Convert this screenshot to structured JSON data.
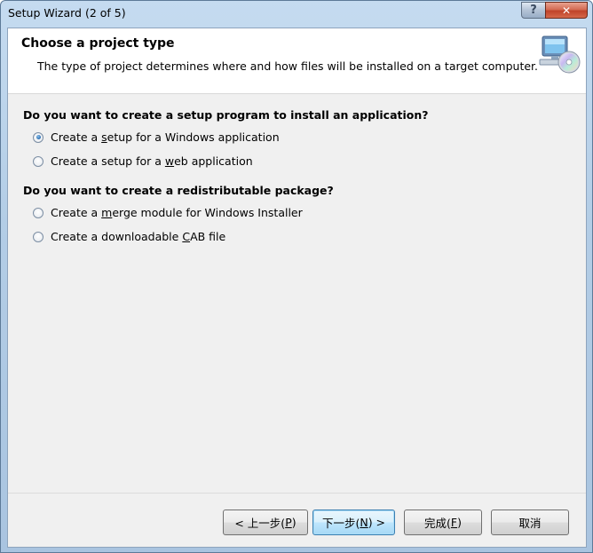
{
  "window": {
    "title": "Setup Wizard (2 of 5)",
    "help_glyph": "?",
    "close_glyph": "✕"
  },
  "header": {
    "title": "Choose a project type",
    "description": "The type of project determines where and how files will be installed on a target computer.",
    "icon": "computer-cd-icon"
  },
  "sections": [
    {
      "question": "Do you want to create a setup program to install an application?",
      "options": [
        {
          "pre": "Create a ",
          "key": "s",
          "post": "etup for a Windows application",
          "selected": true
        },
        {
          "pre": "Create a setup for a ",
          "key": "w",
          "post": "eb application",
          "selected": false
        }
      ]
    },
    {
      "question": "Do you want to create a redistributable package?",
      "options": [
        {
          "pre": "Create a ",
          "key": "m",
          "post": "erge module for Windows Installer",
          "selected": false
        },
        {
          "pre": "Create a downloadable ",
          "key": "C",
          "post": "AB file",
          "selected": false
        }
      ]
    }
  ],
  "buttons": {
    "back": {
      "pre": "< 上一步(",
      "key": "P",
      "post": ")"
    },
    "next": {
      "pre": "下一步(",
      "key": "N",
      "post": ") >"
    },
    "finish": {
      "pre": "完成(",
      "key": "F",
      "post": ")"
    },
    "cancel": {
      "label": "取消"
    }
  }
}
